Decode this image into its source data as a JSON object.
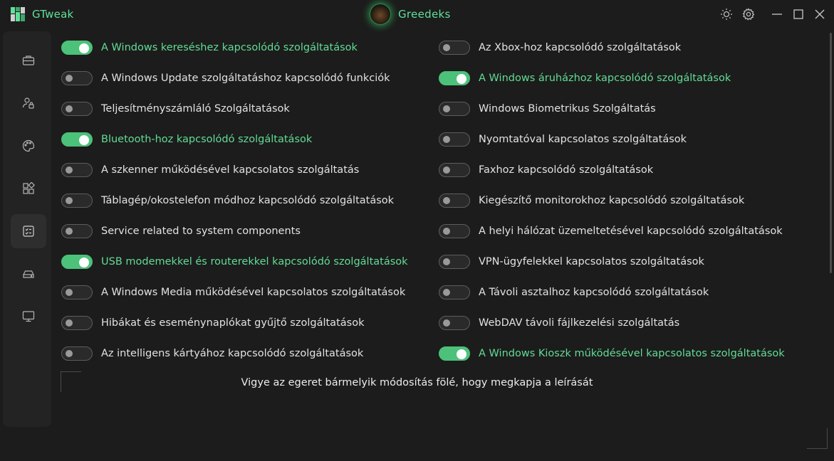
{
  "app": {
    "title": "GTweak",
    "user": "Greedeks"
  },
  "titlebar_buttons": [
    {
      "name": "theme-toggle-button",
      "icon": "sun-icon"
    },
    {
      "name": "settings-button",
      "icon": "gear-icon"
    },
    {
      "name": "minimize-button",
      "icon": "minimize-icon"
    },
    {
      "name": "maximize-button",
      "icon": "maximize-icon"
    },
    {
      "name": "close-button",
      "icon": "close-icon"
    }
  ],
  "sidebar": [
    {
      "name": "nav-toolbox",
      "icon": "briefcase-icon",
      "active": false
    },
    {
      "name": "nav-privacy",
      "icon": "user-lock-icon",
      "active": false
    },
    {
      "name": "nav-interface",
      "icon": "palette-icon",
      "active": false
    },
    {
      "name": "nav-applications",
      "icon": "apps-icon",
      "active": false
    },
    {
      "name": "nav-services",
      "icon": "checklist-icon",
      "active": true
    },
    {
      "name": "nav-system",
      "icon": "drive-icon",
      "active": false
    },
    {
      "name": "nav-sysinfo",
      "icon": "monitor-icon",
      "active": false
    }
  ],
  "services": {
    "left": [
      {
        "label": "A Windows kereséshez kapcsolódó szolgáltatások",
        "on": true
      },
      {
        "label": "A Windows Update szolgáltatáshoz kapcsolódó funkciók",
        "on": false
      },
      {
        "label": "Teljesítményszámláló Szolgáltatások",
        "on": false
      },
      {
        "label": "Bluetooth-hoz kapcsolódó szolgáltatások",
        "on": true
      },
      {
        "label": "A szkenner működésével kapcsolatos szolgáltatás",
        "on": false
      },
      {
        "label": "Táblagép/okostelefon módhoz kapcsolódó szolgáltatások",
        "on": false
      },
      {
        "label": "Service related to system components",
        "on": false
      },
      {
        "label": "USB modemekkel és routerekkel kapcsolódó szolgáltatások",
        "on": true
      },
      {
        "label": "A Windows Media működésével kapcsolatos szolgáltatások",
        "on": false
      },
      {
        "label": "Hibákat és eseménynaplókat gyűjtő szolgáltatások",
        "on": false
      },
      {
        "label": "Az intelligens kártyához kapcsolódó szolgáltatások",
        "on": false
      }
    ],
    "right": [
      {
        "label": "Az Xbox-hoz kapcsolódó szolgáltatások",
        "on": false
      },
      {
        "label": "A Windows áruházhoz kapcsolódó szolgáltatások",
        "on": true
      },
      {
        "label": "Windows Biometrikus Szolgáltatás",
        "on": false
      },
      {
        "label": "Nyomtatóval kapcsolatos szolgáltatások",
        "on": false
      },
      {
        "label": "Faxhoz kapcsolódó szolgáltatások",
        "on": false
      },
      {
        "label": "Kiegészítő monitorokhoz kapcsolódó szolgáltatások",
        "on": false
      },
      {
        "label": "A helyi hálózat üzemeltetésével kapcsolódó szolgáltatások",
        "on": false
      },
      {
        "label": "VPN-ügyfelekkel kapcsolatos szolgáltatások",
        "on": false
      },
      {
        "label": "A Távoli asztalhoz kapcsolódó szolgáltatások",
        "on": false
      },
      {
        "label": "WebDAV távoli fájlkezelési szolgáltatás",
        "on": false
      },
      {
        "label": "A Windows Kioszk működésével kapcsolatos szolgáltatások",
        "on": true
      }
    ]
  },
  "hint": "Vigye az egeret bármelyik módosítás fölé, hogy megkapja a leírását",
  "colors": {
    "accent": "#5fe09a",
    "toggle_on": "#4cc17a",
    "background": "#1c1c1c",
    "sidebar": "#232323"
  }
}
